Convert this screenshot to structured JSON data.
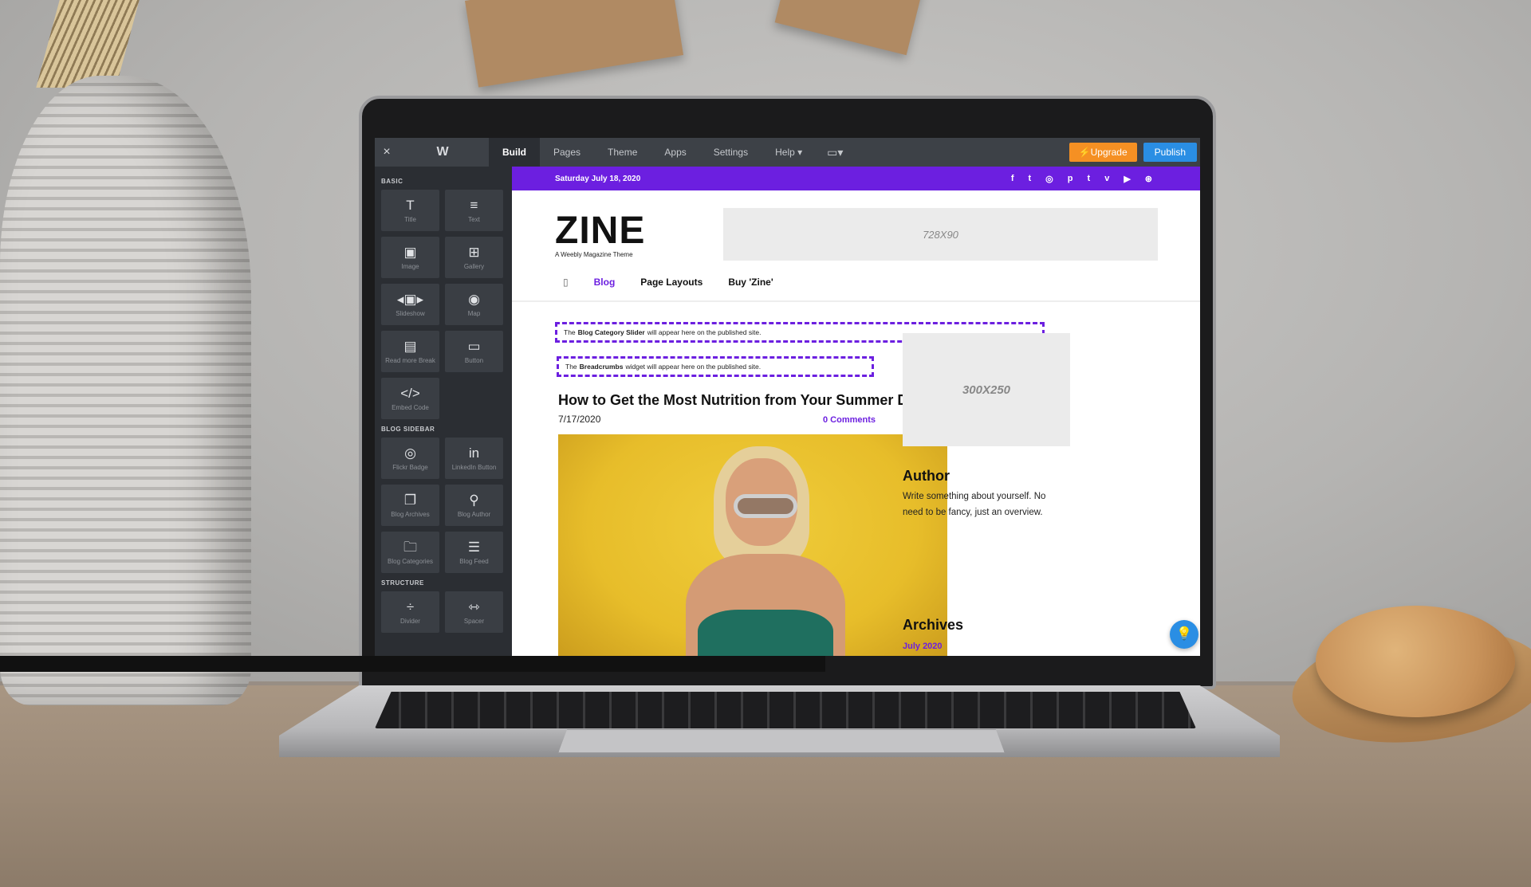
{
  "editor": {
    "close_icon": "×",
    "logo": "W",
    "tabs": [
      {
        "label": "Build"
      },
      {
        "label": "Pages"
      },
      {
        "label": "Theme"
      },
      {
        "label": "Apps"
      },
      {
        "label": "Settings"
      },
      {
        "label": "Help ▾"
      }
    ],
    "device_icon": "▭▾",
    "upgrade_label": "⚡Upgrade",
    "publish_label": "Publish"
  },
  "sidebar": {
    "sections": [
      {
        "title": "BASIC",
        "items": [
          {
            "label": "Title",
            "icon": "T"
          },
          {
            "label": "Text",
            "icon": "≡"
          },
          {
            "label": "Image",
            "icon": "▣"
          },
          {
            "label": "Gallery",
            "icon": "⊞"
          },
          {
            "label": "Slideshow",
            "icon": "◂▣▸"
          },
          {
            "label": "Map",
            "icon": "◉"
          },
          {
            "label": "Read more Break",
            "icon": "▤"
          },
          {
            "label": "Button",
            "icon": "▭"
          },
          {
            "label": "Embed Code",
            "icon": "</>"
          }
        ]
      },
      {
        "title": "BLOG SIDEBAR",
        "items": [
          {
            "label": "Flickr Badge",
            "icon": "◎"
          },
          {
            "label": "LinkedIn Button",
            "icon": "in"
          },
          {
            "label": "Blog Archives",
            "icon": "❐"
          },
          {
            "label": "Blog Author",
            "icon": "⚲"
          },
          {
            "label": "Blog Categories",
            "icon": "🗀"
          },
          {
            "label": "Blog Feed",
            "icon": "☰"
          }
        ]
      },
      {
        "title": "STRUCTURE",
        "items": [
          {
            "label": "Divider",
            "icon": "÷"
          },
          {
            "label": "Spacer",
            "icon": "⇿"
          }
        ]
      }
    ]
  },
  "site": {
    "date": "Saturday July 18, 2020",
    "social_icons": [
      "f",
      "t",
      "◎",
      "p",
      "t",
      "v",
      "▶",
      "⊛"
    ],
    "logo": "ZINE",
    "tagline": "A Weebly Magazine Theme",
    "ad_top": "728X90",
    "menu": {
      "home_icon": "▯",
      "items": [
        "Blog",
        "Page Layouts",
        "Buy 'Zine'"
      ]
    },
    "notice_slider": {
      "pre": "The",
      "bold": "Blog Category Slider",
      "post": "will appear here on the published site."
    },
    "notice_breadcrumbs": {
      "pre": "The",
      "bold": "Breadcrumbs",
      "post": "widget will appear here on the published site."
    },
    "post": {
      "title": "How to Get the Most Nutrition from Your Summer Diet",
      "date": "7/17/2020",
      "comments": "0 Comments"
    },
    "sidebar": {
      "ad": "300X250",
      "author_heading": "Author",
      "author_text": "Write something about yourself. No need to be fancy, just an overview.",
      "archives_heading": "Archives",
      "archives_link": "July 2020"
    },
    "help_icon": "💡"
  },
  "colors": {
    "accent_purple": "#6c1fe0",
    "upgrade_orange": "#f59023",
    "publish_blue": "#2a8ee4",
    "editor_dark": "#2b2e33"
  }
}
